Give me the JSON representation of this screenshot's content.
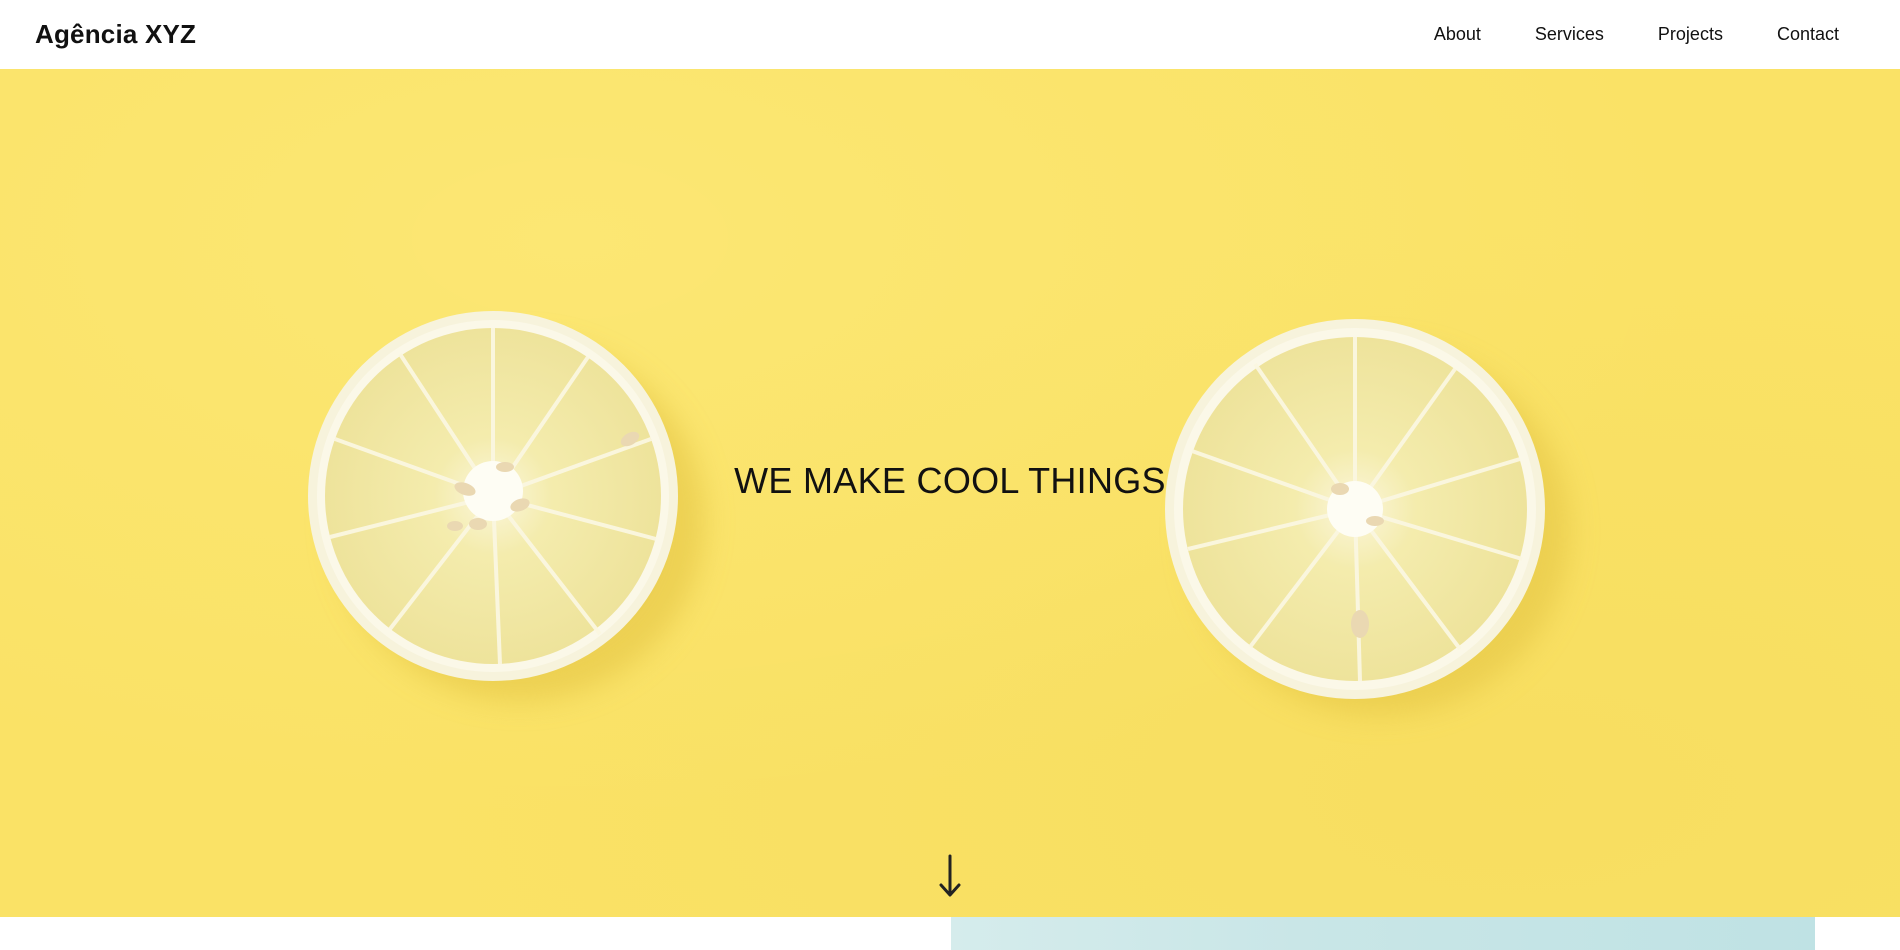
{
  "header": {
    "brand": "Agência XYZ",
    "nav": [
      {
        "label": "About"
      },
      {
        "label": "Services"
      },
      {
        "label": "Projects"
      },
      {
        "label": "Contact"
      }
    ]
  },
  "hero": {
    "title": "WE MAKE COOL THINGS",
    "background_color": "#fae266",
    "scroll_icon": "arrow-down-icon"
  },
  "colors": {
    "text": "#111111",
    "header_bg": "#ffffff",
    "hero_bg": "#fae266",
    "next_section_image": "#c9e6e7"
  }
}
